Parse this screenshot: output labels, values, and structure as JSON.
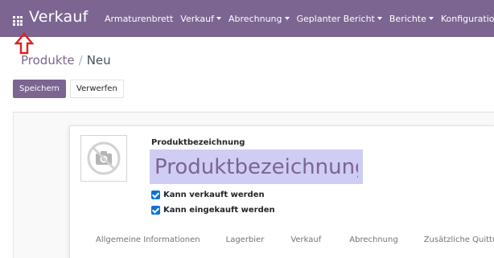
{
  "navbar": {
    "brand": "Verkauf",
    "menu": [
      {
        "label": "Armaturenbrett",
        "dropdown": false
      },
      {
        "label": "Verkauf",
        "dropdown": true
      },
      {
        "label": "Abrechnung",
        "dropdown": true
      },
      {
        "label": "Geplanter Bericht",
        "dropdown": true
      },
      {
        "label": "Berichte",
        "dropdown": true
      },
      {
        "label": "Konfiguration",
        "dropdown": false
      }
    ],
    "background": "#7c6591"
  },
  "breadcrumb": {
    "parent": "Produkte",
    "separator": "/",
    "current": "Neu"
  },
  "buttons": {
    "save": "Speichern",
    "discard": "Verwerfen"
  },
  "form": {
    "name_label": "Produktbezeichnung",
    "name_placeholder": "Produktbezeichnung",
    "image_icon": "camera-slash-icon",
    "checkboxes": [
      {
        "label": "Kann verkauft werden",
        "checked": true
      },
      {
        "label": "Kann eingekauft werden",
        "checked": true
      }
    ],
    "tabs": [
      "Allgemeine Informationen",
      "Lagerbier",
      "Verkauf",
      "Abrechnung",
      "Zusätzliche Quittung"
    ]
  },
  "colors": {
    "accent": "#7c6591",
    "input_highlight": "#cfcdf4",
    "checkbox": "#0d72d8",
    "annotation_arrow": "#e0201f"
  }
}
